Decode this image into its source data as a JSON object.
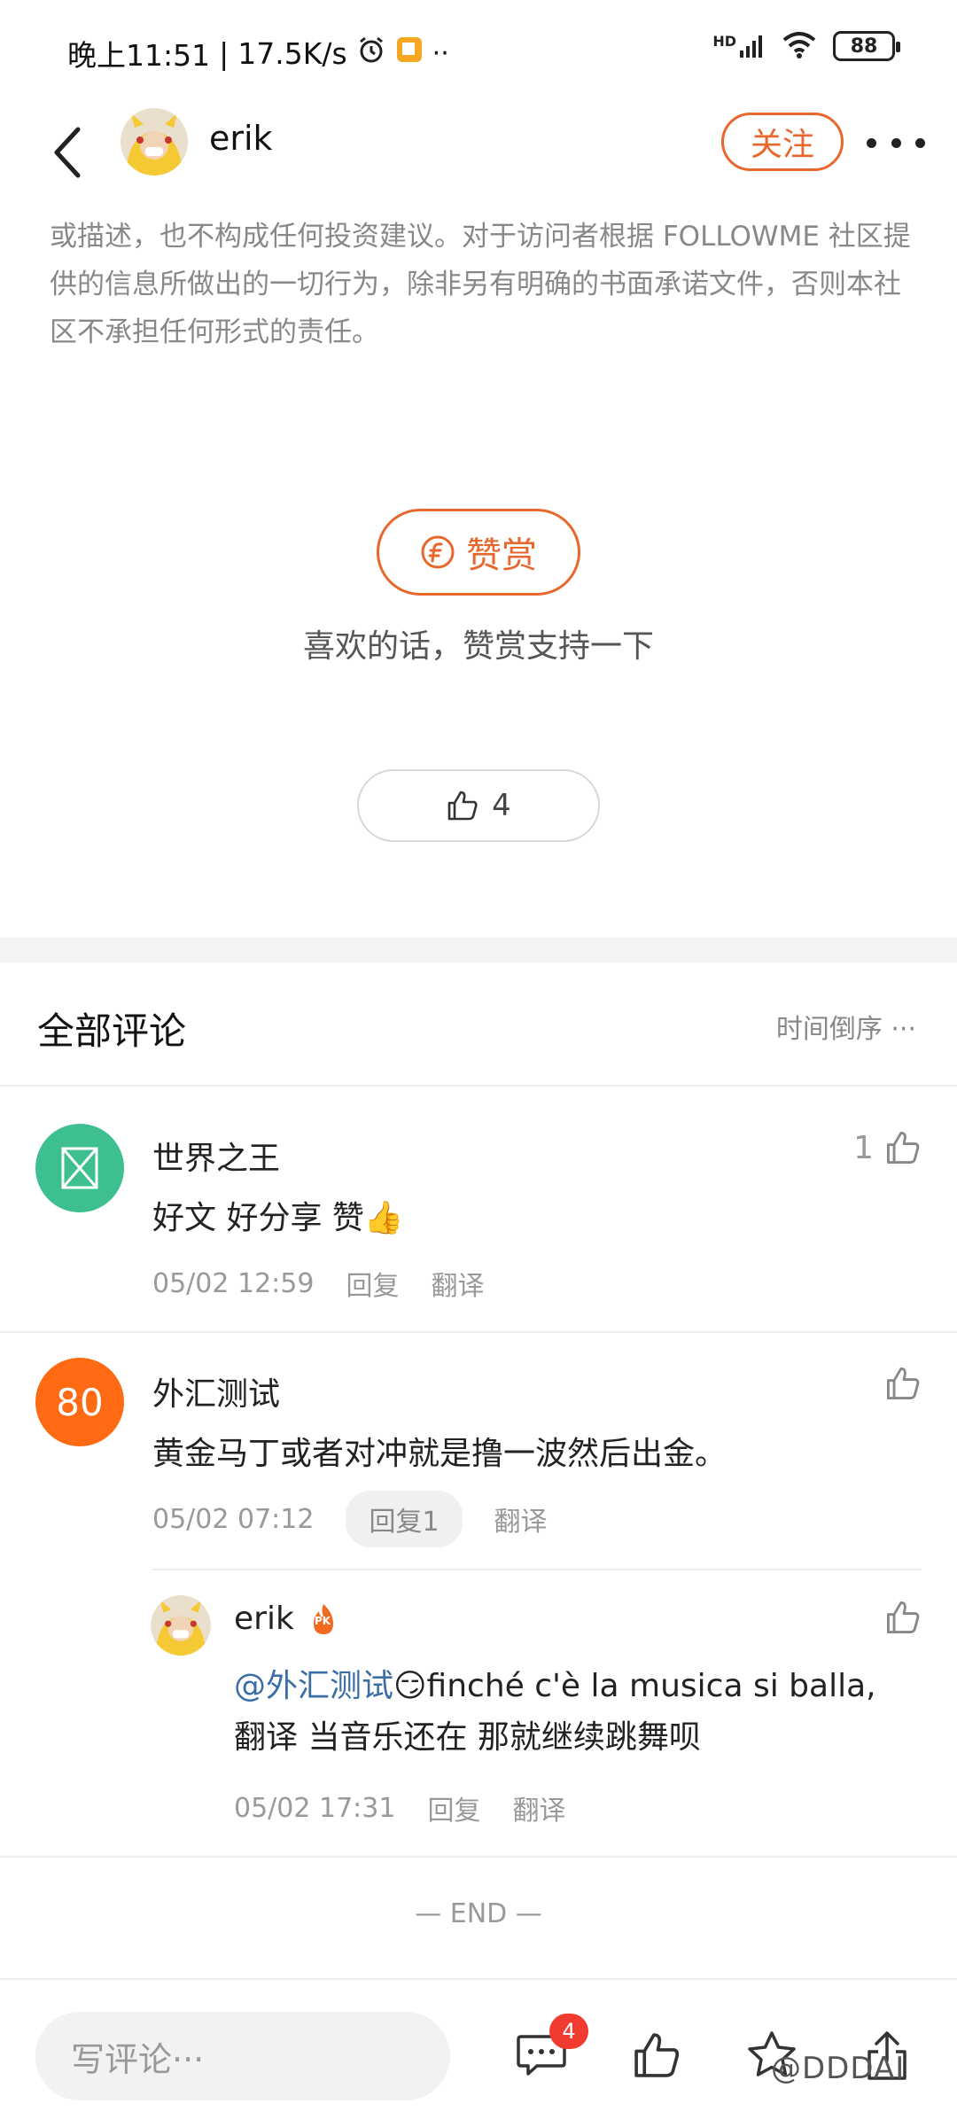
{
  "status_bar": {
    "time": "晚上11:51",
    "speed": "17.5K/s",
    "network": "HD",
    "battery": "88"
  },
  "header": {
    "author_name": "erik",
    "follow_label": "关注"
  },
  "article": {
    "disclaimer": "或描述，也不构成任何投资建议。对于访问者根据 FOLLOWME 社区提供的信息所做出的一切行为，除非另有明确的书面承诺文件，否则本社区不承担任何形式的责任。"
  },
  "reward": {
    "button_label": "赞赏",
    "caption": "喜欢的话，赞赏支持一下"
  },
  "likes": {
    "count": "4"
  },
  "comments_section": {
    "title": "全部评论",
    "sort_label": "时间倒序 ···"
  },
  "comments": [
    {
      "name": "世界之王",
      "text": "好文 好分享 赞👍",
      "time": "05/02 12:59",
      "reply_label": "回复",
      "translate_label": "翻译",
      "like_count": "1"
    },
    {
      "name": "外汇测试",
      "avatar_text": "80",
      "text": "黄金马丁或者对冲就是撸一波然后出金。",
      "time": "05/02 07:12",
      "reply_label": "回复1",
      "translate_label": "翻译",
      "like_count": ""
    }
  ],
  "reply": {
    "name": "erik",
    "badge": "PK",
    "mention": "@外汇测试",
    "line1": "😏finché c'è la musica si balla,",
    "line2": "翻译 当音乐还在 那就继续跳舞呗",
    "time": "05/02 17:31",
    "reply_label": "回复",
    "translate_label": "翻译"
  },
  "end_marker": "— END —",
  "bottom_bar": {
    "input_placeholder": "写评论···",
    "comment_badge": "4",
    "watermark": "@DDDAI"
  },
  "colors": {
    "accent": "#e8672c",
    "green_avatar": "#3dbf8f",
    "orange_avatar": "#ff6a13",
    "badge_red": "#f23b30"
  }
}
